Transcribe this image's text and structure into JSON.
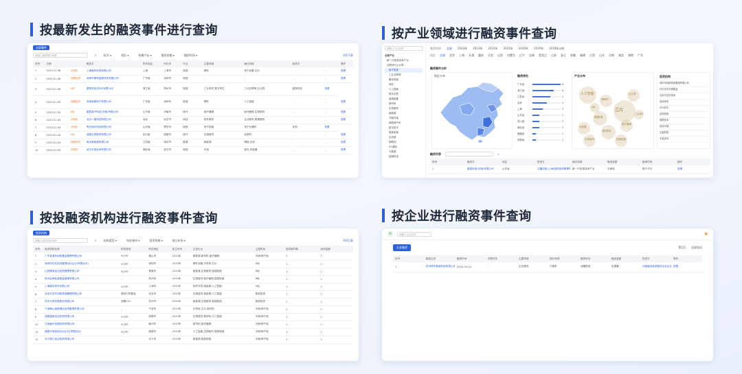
{
  "titles": {
    "latest": "按最新发生的融资事件进行查询",
    "industry": "按产业领域进行融资事件查询",
    "investor": "按投融资机构进行融资事件查询",
    "company": "按企业进行融资事件查询"
  },
  "panel1": {
    "tab": "全部事件",
    "search_placeholder": "请输入融资事件标题",
    "filters": [
      "轮次",
      "地区",
      "所属产业",
      "融资金额",
      "融资时间"
    ],
    "pager": "共1万条",
    "headers": [
      "序号",
      "日期",
      "",
      "融资方",
      "所在地区",
      "所在市",
      "行业",
      "主要领域",
      "细分领域",
      "投资方",
      "",
      "操作"
    ],
    "rows": [
      [
        "1",
        "2023-01-06",
        "天使轮",
        "上海星际科技有限公司",
        "上海",
        "上海市",
        "制造",
        "硬件",
        "电子设备,芯片",
        "-",
        "-",
        "查看"
      ],
      [
        "2",
        "2023-01-06",
        "战略投资",
        "深圳市微科智能科技有限公司",
        "广东省",
        "深圳市",
        "制造",
        "-",
        "-",
        "-",
        "-",
        "查看"
      ],
      [
        "3",
        "2023-01-06",
        "A轮",
        "星联科技(杭州)有限公司",
        "浙江省",
        "杭州市",
        "制造",
        "工业软件,数字孪生",
        "工业互联网,云计算",
        "越钦科技",
        "查看"
      ],
      [
        "4",
        "2023-01-05",
        "战略投资",
        "深圳南棠电子有限公司",
        "广东省",
        "深圳市",
        "制造",
        "硬件",
        "人工智能",
        "-",
        "-",
        "查看"
      ],
      [
        "5",
        "2023-01-05",
        "B轮",
        "星辰医疗科技(济南)有限公司",
        "山东省",
        "济南市",
        "医疗",
        "医疗器械",
        "医疗器械,生物制药",
        "-",
        "-",
        "查看"
      ],
      [
        "6",
        "2023-01-05",
        "天使轮",
        "北京一星科技有限公司",
        "北京",
        "北京市",
        "科技",
        "软件服务",
        "企业服务,数据服务",
        "-",
        "-",
        "查看"
      ],
      [
        "7",
        "2023-01-04",
        "天使轮",
        "青岛海天科技有限公司",
        "山东省",
        "青岛市",
        "制造",
        "电子制造",
        "电子元器件",
        "未知",
        "查看"
      ],
      [
        "8",
        "2023-01-04",
        "A轮",
        "成都生物医药有限公司",
        "四川省",
        "成都市",
        "医疗",
        "生物医药",
        "创新药",
        "-",
        "-",
        "查看"
      ],
      [
        "9",
        "2023-01-04",
        "战略投资",
        "南京新能源有限公司",
        "江苏省",
        "南京市",
        "能源",
        "新能源",
        "储能,光伏",
        "-",
        "-",
        "查看"
      ],
      [
        "10",
        "2023-01-03",
        "天使轮",
        "武汉光电技术有限公司",
        "湖北省",
        "武汉市",
        "制造",
        "光电",
        "激光,传感器",
        "-",
        "-",
        "查看"
      ]
    ]
  },
  "panel2": {
    "sidebar_search": "请输入产业名称",
    "sidebar_items": [
      "全部产业",
      "新一代信息技术产业",
      "互联网与云计算",
      "电子信息",
      "工业互联网",
      "集成电路",
      "软件",
      "人工智能",
      "数字创意",
      "高端装备",
      "新材料",
      "生物医药",
      "新能源",
      "节能环保",
      "新能源汽车",
      "航空航天",
      "智能制造",
      "区块链",
      "物联网",
      "5G通信",
      "大数据",
      "金融科技"
    ],
    "years_label": "融资时间",
    "years": [
      "全部",
      "2024年",
      "2023年",
      "2022年",
      "2021年",
      "2020年",
      "2019年",
      "2018年以前"
    ],
    "regions_label": "地区",
    "regions": [
      "全部",
      "北京",
      "上海",
      "天津",
      "重庆",
      "河北",
      "山西",
      "内蒙古",
      "辽宁",
      "吉林",
      "黑龙江",
      "江苏",
      "浙江",
      "安徽",
      "福建",
      "江西",
      "山东",
      "河南",
      "湖北",
      "湖南",
      "广东"
    ],
    "map_title": "融资事件分析",
    "map_subtitle": "地区分布",
    "rank_title": "融资排名",
    "rank_items": [
      {
        "name": "广东省",
        "value": 8
      },
      {
        "name": "浙江省",
        "value": 6
      },
      {
        "name": "江苏省",
        "value": 5
      },
      {
        "name": "北京",
        "value": 4
      },
      {
        "name": "上海",
        "value": 3
      },
      {
        "name": "山东省",
        "value": 2
      },
      {
        "name": "四川省",
        "value": 2
      },
      {
        "name": "湖北省",
        "value": 2
      },
      {
        "name": "福建省",
        "value": 1
      },
      {
        "name": "安徽省",
        "value": 1
      }
    ],
    "cloud_title": "产业分布",
    "cloud_words": [
      "人工智能",
      "芯片",
      "新能源",
      "医疗器械",
      "大数据",
      "云计算",
      "物联网",
      "生物医药",
      "智能制造",
      "新材料",
      "工业软件",
      "储能"
    ],
    "invest_title": "投资机构",
    "invest_items": [
      "深圳市创新投资集团有限公司",
      "红杉资本中国基金",
      "北京中关村投资",
      "高瓴资本",
      "IDG资本",
      "启明创投",
      "君联资本",
      "经纬中国",
      "达晨财智",
      "中金资本"
    ],
    "list_title": "融资列表",
    "list_headers": [
      "序号",
      "融资方",
      "地区",
      "投资方",
      "细分领域",
      "融资金额",
      "融资时间",
      "操作"
    ],
    "list_row": [
      "1",
      "星辰科技(济南)有限公司",
      "山东省",
      "达晨创投(上海)股权投资管理有限公司",
      "新一代信息技术产业",
      "天使轮",
      "数千万元",
      "查看"
    ]
  },
  "panel3": {
    "tab": "投资机构",
    "search_placeholder": "请输入投资机构名称",
    "filters": [
      "机构类型",
      "所在城市",
      "投资领域",
      "成立年份"
    ],
    "pager": "共4万条",
    "headers": [
      "序号",
      "投资机构名称",
      "机构类型",
      "所在地区",
      "成立年份",
      "主投行业",
      "主投阶段",
      "投资事件数",
      "投资金额"
    ],
    "rows": [
      [
        "1",
        "广东省粤科创新基金管理有限公司",
        "VC/PE",
        "佛山市",
        "2024年",
        "新能源,新材料,医疗器械",
        "天使/种子轮",
        "2",
        "1"
      ],
      [
        "2",
        "深圳市红杉投资管理合伙企业(有限合伙)",
        "VC/PE",
        "深圳市",
        "2024年",
        "硬件设备,半导体,芯片",
        "A轮",
        "1",
        "1"
      ],
      [
        "3",
        "山西晋城创业投资管理有限公司",
        "VC/PE",
        "晋城市",
        "2024年",
        "新能源,生物医药,智能制造",
        "B轮",
        "1",
        "1"
      ],
      [
        "4",
        "杭州启明私募基金管理有限公司",
        "-",
        "杭州市",
        "2024年",
        "生物医药,医疗器械,智能制造",
        "B轮",
        "1",
        "1"
      ],
      [
        "5",
        "上海星际资本有限公司",
        "VC/PE",
        "上海市",
        "2024年",
        "软件开发,新能源,人工智能",
        "A轮",
        "1",
        "1"
      ],
      [
        "6",
        "北京中关村创新投资管理有限公司",
        "政府引导基金",
        "北京市",
        "2024年",
        "生物医药,新能源,人工智能",
        "股权投资",
        "1",
        "1"
      ],
      [
        "7",
        "苏州元禾控股股份有限公司",
        "战略CVC",
        "苏州市",
        "2024年",
        "新能源,生物医药,智能制造",
        "股权投资",
        "1",
        "1"
      ],
      [
        "8",
        "宁波梅山保税港区投资管理有限公司",
        "-",
        "宁波市",
        "2024年",
        "半导体,芯片,新材料",
        "天使/种子轮",
        "1",
        "1"
      ],
      [
        "9",
        "成都高新创业投资有限公司",
        "VC/PE",
        "成都市",
        "2024年",
        "生物医药,新材料,人工智能",
        "天使/种子轮",
        "1",
        "1"
      ],
      [
        "10",
        "江西赣州创新投资有限公司",
        "VC/PE",
        "赣州市",
        "2024年",
        "新材料,医疗器械",
        "天使/种子轮",
        "1",
        "1"
      ],
      [
        "11",
        "南昌天使投资合伙企业(有限合伙)",
        "VC/PE",
        "南昌市",
        "2024年",
        "人工智能,生物医药,智能制造",
        "天使/种子轮",
        "1",
        "1"
      ],
      [
        "12",
        "长沙湘江创业投资有限公司",
        "-",
        "长沙市",
        "2024年",
        "新能源,智能制造",
        "天使/种子轮",
        "1",
        "1"
      ]
    ]
  },
  "panel4": {
    "search_placeholder": "请输入企业名称",
    "tab": "企业融资",
    "pager_left": "第1页",
    "pager_right": "全部导出",
    "headers": [
      "序号",
      "融资主体",
      "融资时间",
      "关联关系",
      "主要领域",
      "细分领域",
      "融资轮次",
      "融资金额",
      "投资方",
      "操作"
    ],
    "row": [
      "1",
      "杭州博华智能科技有限公司",
      "2024-09-04",
      "-",
      "企业服务",
      "IT服务",
      "战略投资",
      "未披露",
      "河南鑫鸿技术服务合伙企业",
      "查看"
    ]
  },
  "colors": {
    "accent": "#2d5fd6",
    "orange": "#e8833a",
    "map": "#8fb1ef"
  }
}
